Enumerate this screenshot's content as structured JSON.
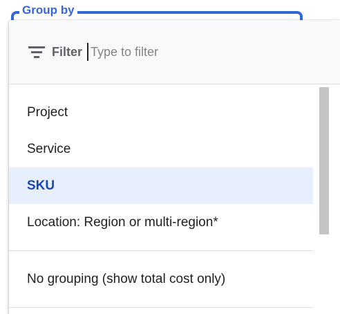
{
  "field": {
    "label": "Group by"
  },
  "filter": {
    "label": "Filter",
    "placeholder": "Type to filter",
    "value": ""
  },
  "options": [
    {
      "label": "Project",
      "selected": false
    },
    {
      "label": "Service",
      "selected": false
    },
    {
      "label": "SKU",
      "selected": true
    },
    {
      "label": "Location: Region or multi-region*",
      "selected": false
    }
  ],
  "extra_option": {
    "label": "No grouping (show total cost only)"
  },
  "colors": {
    "accent": "#3367d6",
    "selected_bg": "#e8effc",
    "selected_text": "#1a47b8"
  }
}
